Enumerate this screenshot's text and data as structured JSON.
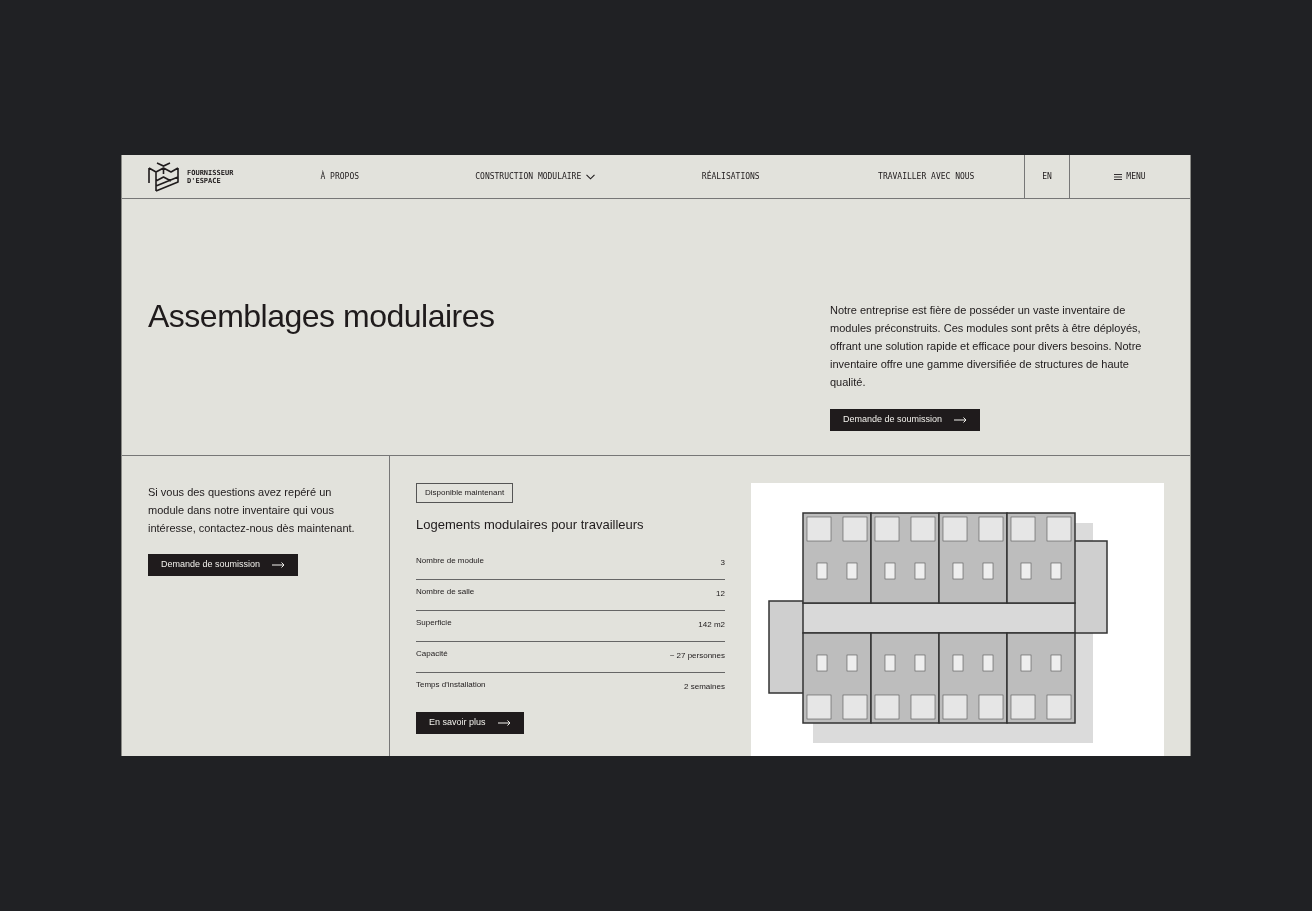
{
  "header": {
    "logo_text": [
      "FOURNISSEUR",
      "D'ESPACE"
    ],
    "nav": [
      {
        "label": "À PROPOS",
        "has_dropdown": false
      },
      {
        "label": "CONSTRUCTION MODULAIRE",
        "has_dropdown": true
      },
      {
        "label": "RÉALISATIONS",
        "has_dropdown": false
      },
      {
        "label": "TRAVAILLER AVEC NOUS",
        "has_dropdown": false
      }
    ],
    "language": "EN",
    "menu": "MENU"
  },
  "hero": {
    "title": "Assemblages modulaires",
    "description": "Notre entreprise est fière de posséder un vaste inventaire de modules préconstruits. Ces modules sont prêts à être déployés, offrant une solution rapide et efficace pour divers besoins. Notre inventaire offre une gamme diversifiée de structures de haute qualité.",
    "button": "Demande de soumission"
  },
  "contact": {
    "text": "Si vous des questions avez repéré un module dans notre inventaire qui vous intéresse, contactez-nous dès maintenant.",
    "button": "Demande de soumission"
  },
  "listing": {
    "badge": "Disponible maintenant",
    "title": "Logements modulaires pour travailleurs",
    "specs": [
      {
        "label": "Nombre de module",
        "value": "3"
      },
      {
        "label": "Nombre de salle",
        "value": "12"
      },
      {
        "label": "Superficie",
        "value": "142 m2"
      },
      {
        "label": "Capacité",
        "value": "~ 27 personnes"
      },
      {
        "label": "Temps d'installation",
        "value": "2 semaines"
      }
    ],
    "button": "En savoir plus"
  }
}
